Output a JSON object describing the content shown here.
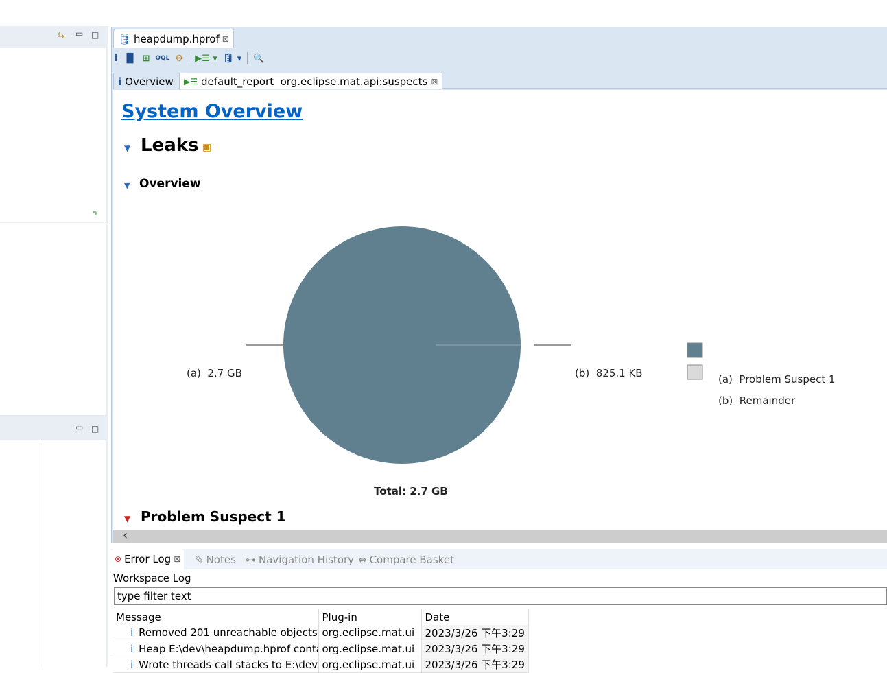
{
  "editor": {
    "tab_label": "heapdump.hprof",
    "subtabs": [
      {
        "label": "Overview"
      },
      {
        "label": "default_report  org.eclipse.mat.api:suspects"
      }
    ]
  },
  "toolbar": [
    "info-icon",
    "histogram-icon",
    "dominator-tree-icon",
    "oql-icon",
    "settings-icon",
    "run-report-icon",
    "heap-dump-actions-icon",
    "search-icon"
  ],
  "report": {
    "title": "System Overview",
    "section": "Leaks",
    "subsection": "Overview",
    "next_section": "Problem Suspect 1"
  },
  "chart_data": {
    "type": "pie",
    "slices": [
      {
        "label": "(a)",
        "name": "Problem Suspect 1",
        "value_text": "2.7 GB",
        "value_bytes": 2700000000.0,
        "color": "#607f8f"
      },
      {
        "label": "(b)",
        "name": "Remainder",
        "value_text": "825.1 KB",
        "value_bytes": 825100,
        "color": "#dadada"
      }
    ],
    "slice_labels": [
      "(a)  2.7 GB",
      "(b)  825.1 KB"
    ],
    "legend": [
      "(a)  Problem Suspect 1",
      "(b)  Remainder"
    ],
    "legend_position": "right",
    "total": "Total: 2.7 GB"
  },
  "bottom": {
    "tabs": [
      "Error Log",
      "Notes",
      "Navigation History",
      "Compare Basket"
    ],
    "log_title": "Workspace Log",
    "filter_placeholder": "type filter text",
    "columns": [
      "Message",
      "Plug-in",
      "Date"
    ],
    "rows": [
      {
        "message": "Removed 201 unreachable objects",
        "plugin": "org.eclipse.mat.ui",
        "date": "2023/3/26 下午3:29"
      },
      {
        "message": "Heap E:\\dev\\heapdump.hprof contains",
        "plugin": "org.eclipse.mat.ui",
        "date": "2023/3/26 下午3:29"
      },
      {
        "message": "Wrote threads call stacks to E:\\dev\\",
        "plugin": "org.eclipse.mat.ui",
        "date": "2023/3/26 下午3:29"
      }
    ]
  }
}
